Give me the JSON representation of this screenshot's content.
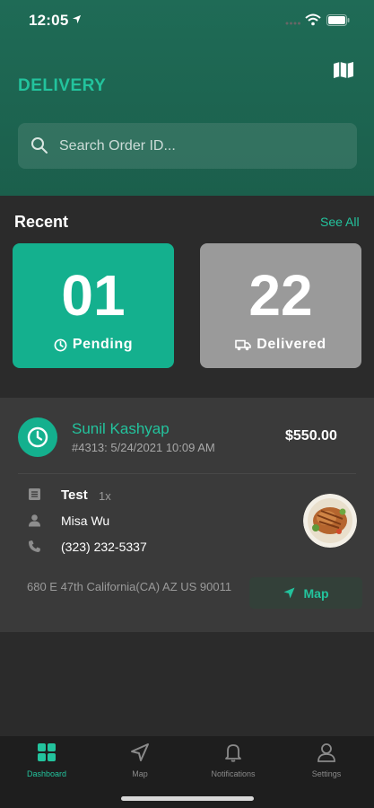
{
  "status_bar": {
    "time": "12:05"
  },
  "header": {
    "title": "DELIVERY",
    "map_icon": "map-icon"
  },
  "search": {
    "placeholder": "Search Order ID..."
  },
  "recent": {
    "title": "Recent",
    "see_all": "See All",
    "cards": [
      {
        "count": "01",
        "label": "Pending",
        "icon": "clock-icon",
        "color": "#14b08e"
      },
      {
        "count": "22",
        "label": "Delivered",
        "icon": "truck-icon",
        "color": "#9a9a9a"
      }
    ]
  },
  "order": {
    "customer": "Sunil Kashyap",
    "meta": "#4313: 5/24/2021 10:09 AM",
    "price": "$550.00",
    "item": {
      "name": "Test",
      "qty": "1x"
    },
    "contact_name": "Misa Wu",
    "phone": "(323) 232-5337",
    "address": "680 E 47th California(CA) AZ US 90011",
    "map_button": "Map"
  },
  "tabs": [
    {
      "label": "Dashboard",
      "icon": "dashboard-icon",
      "active": true
    },
    {
      "label": "Map",
      "icon": "navigation-icon",
      "active": false
    },
    {
      "label": "Notifications",
      "icon": "bell-icon",
      "active": false
    },
    {
      "label": "Settings",
      "icon": "user-icon",
      "active": false
    }
  ],
  "colors": {
    "accent": "#23c39d",
    "header_bg": "#1f6b56",
    "background": "#2b2b2b",
    "card_bg": "#3a3a3a"
  }
}
